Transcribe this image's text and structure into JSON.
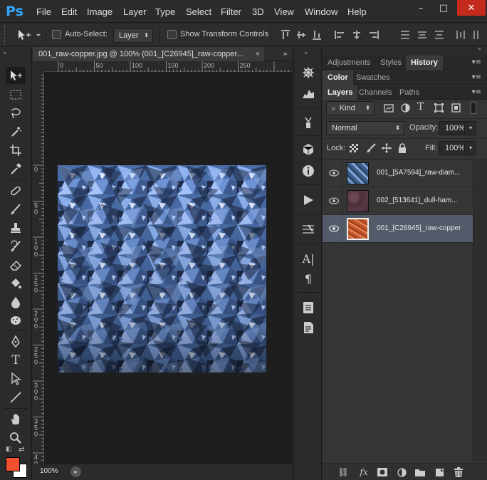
{
  "app": {
    "logo": "Ps"
  },
  "menu": [
    "File",
    "Edit",
    "Image",
    "Layer",
    "Type",
    "Select",
    "Filter",
    "3D",
    "View",
    "Window",
    "Help"
  ],
  "window_controls": {
    "minimize": "–",
    "maximize": "□",
    "close": "✕"
  },
  "options": {
    "auto_select_label": "Auto-Select:",
    "auto_select_value": "Layer",
    "transform_label": "Show Transform Controls"
  },
  "document": {
    "tab_title": "001_raw-copper.jpg @ 100% (001_[C26945]_raw-copper...",
    "zoom": "100%",
    "ruler_top": [
      "0",
      "50",
      "100",
      "150",
      "200",
      "250"
    ],
    "ruler_left": [
      "0",
      "5\n0",
      "1\n0\n0",
      "1\n5\n0",
      "2\n0\n0",
      "2\n5\n0",
      "3\n0\n0",
      "3\n5\n0",
      "4\n0\n0",
      "4\n5\n0",
      "5\n0\n0"
    ]
  },
  "panels": {
    "group1_tabs": [
      "Adjustments",
      "Styles",
      "History"
    ],
    "group2_tabs": [
      "Color",
      "Swatches"
    ],
    "group3_tabs": [
      "Layers",
      "Channels",
      "Paths"
    ],
    "kind_label": "Kind",
    "blend_mode": "Normal",
    "opacity_label": "Opacity:",
    "opacity_value": "100%",
    "lock_label": "Lock:",
    "fill_label": "Fill:",
    "fill_value": "100%",
    "layers": [
      {
        "name": "001_[5A7594]_raw-diam...",
        "color": "#5a7594"
      },
      {
        "name": "002_[513641]_dull-ham...",
        "color": "#513641"
      },
      {
        "name": "001_[C26945]_raw-copper",
        "color": "#c26945"
      }
    ],
    "footer_fx": "fx"
  },
  "colors": {
    "foreground": "#f2502f",
    "background": "#ffffff",
    "accent": "#31a8ff"
  }
}
